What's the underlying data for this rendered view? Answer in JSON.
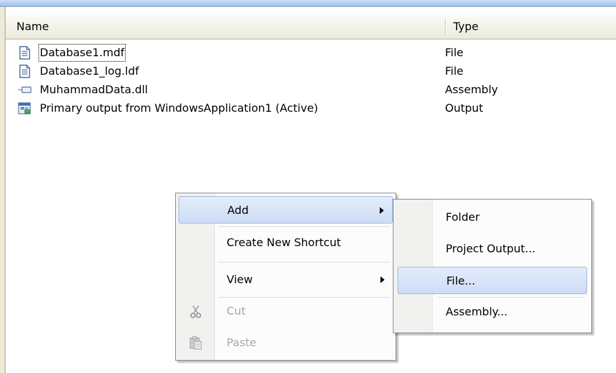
{
  "header": {
    "name_label": "Name",
    "type_label": "Type"
  },
  "files": [
    {
      "name": "Database1.mdf",
      "type": "File",
      "icon": "document-icon"
    },
    {
      "name": "Database1_log.ldf",
      "type": "File",
      "icon": "document-icon"
    },
    {
      "name": "MuhammadData.dll",
      "type": "Assembly",
      "icon": "assembly-icon"
    },
    {
      "name": "Primary output from WindowsApplication1 (Active)",
      "type": "Output",
      "icon": "project-output-icon"
    }
  ],
  "context_menu": {
    "add": "Add",
    "create_shortcut": "Create New Shortcut",
    "view": "View",
    "cut": "Cut",
    "paste": "Paste"
  },
  "submenu": {
    "folder": "Folder",
    "project_output": "Project Output...",
    "file": "File...",
    "assembly": "Assembly..."
  },
  "colors": {
    "highlight": "#cddcf5",
    "highlight_border": "#9fb8e0",
    "disabled_text": "#a7a7a7"
  }
}
